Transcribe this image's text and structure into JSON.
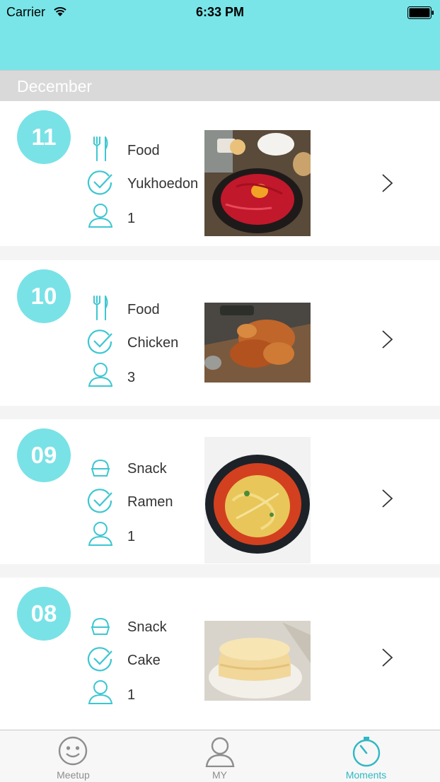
{
  "status_bar": {
    "carrier": "Carrier",
    "time": "6:33 PM"
  },
  "section": {
    "title": "December"
  },
  "colors": {
    "accent": "#7ae5e8",
    "circle": "#79e2e6",
    "icon": "#3cc7d2",
    "active_tab": "#2fb8c3"
  },
  "moments": [
    {
      "day": "11",
      "category": "Food",
      "category_icon": "fork-knife-icon",
      "dish": "Yukhoedon",
      "people": "1",
      "photo": "yukhoedon-photo"
    },
    {
      "day": "10",
      "category": "Food",
      "category_icon": "fork-knife-icon",
      "dish": "Chicken",
      "people": "3",
      "photo": "chicken-photo"
    },
    {
      "day": "09",
      "category": "Snack",
      "category_icon": "cupcake-icon",
      "dish": "Ramen",
      "people": "1",
      "photo": "ramen-photo"
    },
    {
      "day": "08",
      "category": "Snack",
      "category_icon": "cupcake-icon",
      "dish": "Cake",
      "people": "1",
      "photo": "cake-photo"
    }
  ],
  "tab_bar": {
    "tabs": [
      {
        "label": "Meetup",
        "icon": "smiley-icon",
        "active": false
      },
      {
        "label": "MY",
        "icon": "person-icon",
        "active": false
      },
      {
        "label": "Moments",
        "icon": "stopwatch-icon",
        "active": true
      }
    ]
  }
}
